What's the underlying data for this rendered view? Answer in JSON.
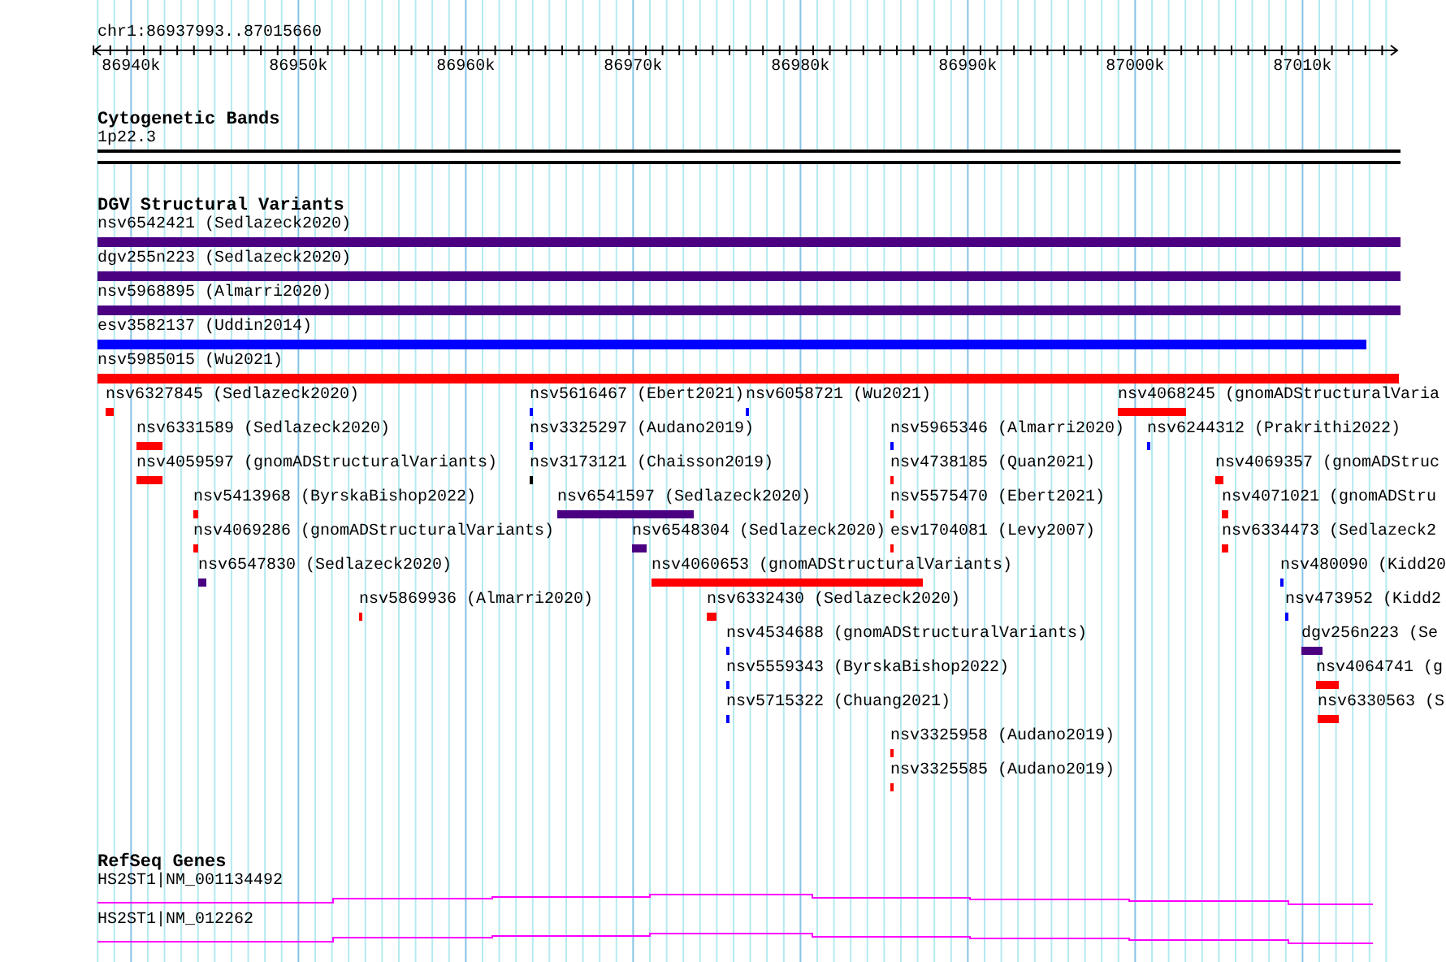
{
  "ruler": {
    "location": "chr1:86937993..87015660",
    "ticks": [
      {
        "label": "86940k"
      },
      {
        "label": "86950k"
      },
      {
        "label": "86960k"
      },
      {
        "label": "86970k"
      },
      {
        "label": "86980k"
      },
      {
        "label": "86990k"
      },
      {
        "label": "87000k"
      },
      {
        "label": "87010k"
      }
    ]
  },
  "cytogenetic_bands": {
    "title": "Cytogenetic Bands",
    "band": "1p22.3"
  },
  "dgv": {
    "title": "DGV Structural Variants",
    "full_rows": [
      {
        "label": "nsv6542421 (Sedlazeck2020)",
        "color": "#4b0082"
      },
      {
        "label": "dgv255n223 (Sedlazeck2020)",
        "color": "#4b0082"
      },
      {
        "label": "nsv5968895 (Almarri2020)",
        "color": "#4b0082"
      },
      {
        "label": "esv3582137 (Uddin2014)",
        "color": "#0000ff"
      },
      {
        "label": "nsv5985015 (Wu2021)",
        "color": "#ff0000"
      }
    ],
    "lanes": [
      {
        "features": [
          {
            "label": "nsv6327845 (Sedlazeck2020)",
            "color": "#ff0000"
          },
          {
            "label": "nsv5616467 (Ebert2021)",
            "color": "#0000ff"
          },
          {
            "label": "nsv6058721 (Wu2021)",
            "color": "#0000ff"
          },
          {
            "label": "nsv4068245 (gnomADStructuralVaria",
            "color": "#ff0000"
          }
        ]
      },
      {
        "features": [
          {
            "label": "nsv6331589 (Sedlazeck2020)",
            "color": "#ff0000"
          },
          {
            "label": "nsv3325297 (Audano2019)",
            "color": "#0000ff"
          },
          {
            "label": "nsv5965346 (Almarri2020)",
            "color": "#0000ff"
          },
          {
            "label": "nsv6244312 (Prakrithi2022)",
            "color": "#0000ff"
          }
        ]
      },
      {
        "features": [
          {
            "label": "nsv4059597 (gnomADStructuralVariants)",
            "color": "#ff0000"
          },
          {
            "label": "nsv3173121 (Chaisson2019)",
            "color": "#000000"
          },
          {
            "label": "nsv4738185 (Quan2021)",
            "color": "#ff0000"
          },
          {
            "label": "nsv4069357 (gnomADStruc",
            "color": "#ff0000"
          }
        ]
      },
      {
        "features": [
          {
            "label": "nsv5413968 (ByrskaBishop2022)",
            "color": "#ff0000"
          },
          {
            "label": "nsv6541597 (Sedlazeck2020)",
            "color": "#4b0082"
          },
          {
            "label": "nsv5575470 (Ebert2021)",
            "color": "#ff0000"
          },
          {
            "label": "nsv4071021 (gnomADStru",
            "color": "#ff0000"
          }
        ]
      },
      {
        "features": [
          {
            "label": "nsv4069286 (gnomADStructuralVariants)",
            "color": "#ff0000"
          },
          {
            "label": "nsv6548304 (Sedlazeck2020)",
            "color": "#4b0082"
          },
          {
            "label": "esv1704081 (Levy2007)",
            "color": "#ff0000"
          },
          {
            "label": "nsv6334473 (Sedlazeck2",
            "color": "#ff0000"
          }
        ]
      },
      {
        "features": [
          {
            "label": "nsv6547830 (Sedlazeck2020)",
            "color": "#4b0082"
          },
          {
            "label": "nsv4060653 (gnomADStructuralVariants)",
            "color": "#ff0000"
          },
          {
            "label": "nsv480090 (Kidd20",
            "color": "#0000ff"
          }
        ]
      },
      {
        "features": [
          {
            "label": "nsv5869936 (Almarri2020)",
            "color": "#ff0000"
          },
          {
            "label": "nsv6332430 (Sedlazeck2020)",
            "color": "#ff0000"
          },
          {
            "label": "nsv473952 (Kidd2",
            "color": "#0000ff"
          }
        ]
      },
      {
        "features": [
          {
            "label": "nsv4534688 (gnomADStructuralVariants)",
            "color": "#0000ff"
          },
          {
            "label": "dgv256n223 (Se",
            "color": "#4b0082"
          }
        ]
      },
      {
        "features": [
          {
            "label": "nsv5559343 (ByrskaBishop2022)",
            "color": "#0000ff"
          },
          {
            "label": "nsv4064741 (g",
            "color": "#ff0000"
          }
        ]
      },
      {
        "features": [
          {
            "label": "nsv5715322 (Chuang2021)",
            "color": "#0000ff"
          },
          {
            "label": "nsv6330563 (S",
            "color": "#ff0000"
          }
        ]
      },
      {
        "features": [
          {
            "label": "nsv3325958 (Audano2019)",
            "color": "#ff0000"
          }
        ]
      },
      {
        "features": [
          {
            "label": "nsv3325585 (Audano2019)",
            "color": "#ff0000"
          }
        ]
      }
    ]
  },
  "refseq_genes": {
    "title": "RefSeq Genes",
    "genes": [
      {
        "label": "HS2ST1|NM_001134492"
      },
      {
        "label": "HS2ST1|NM_012262"
      }
    ]
  }
}
